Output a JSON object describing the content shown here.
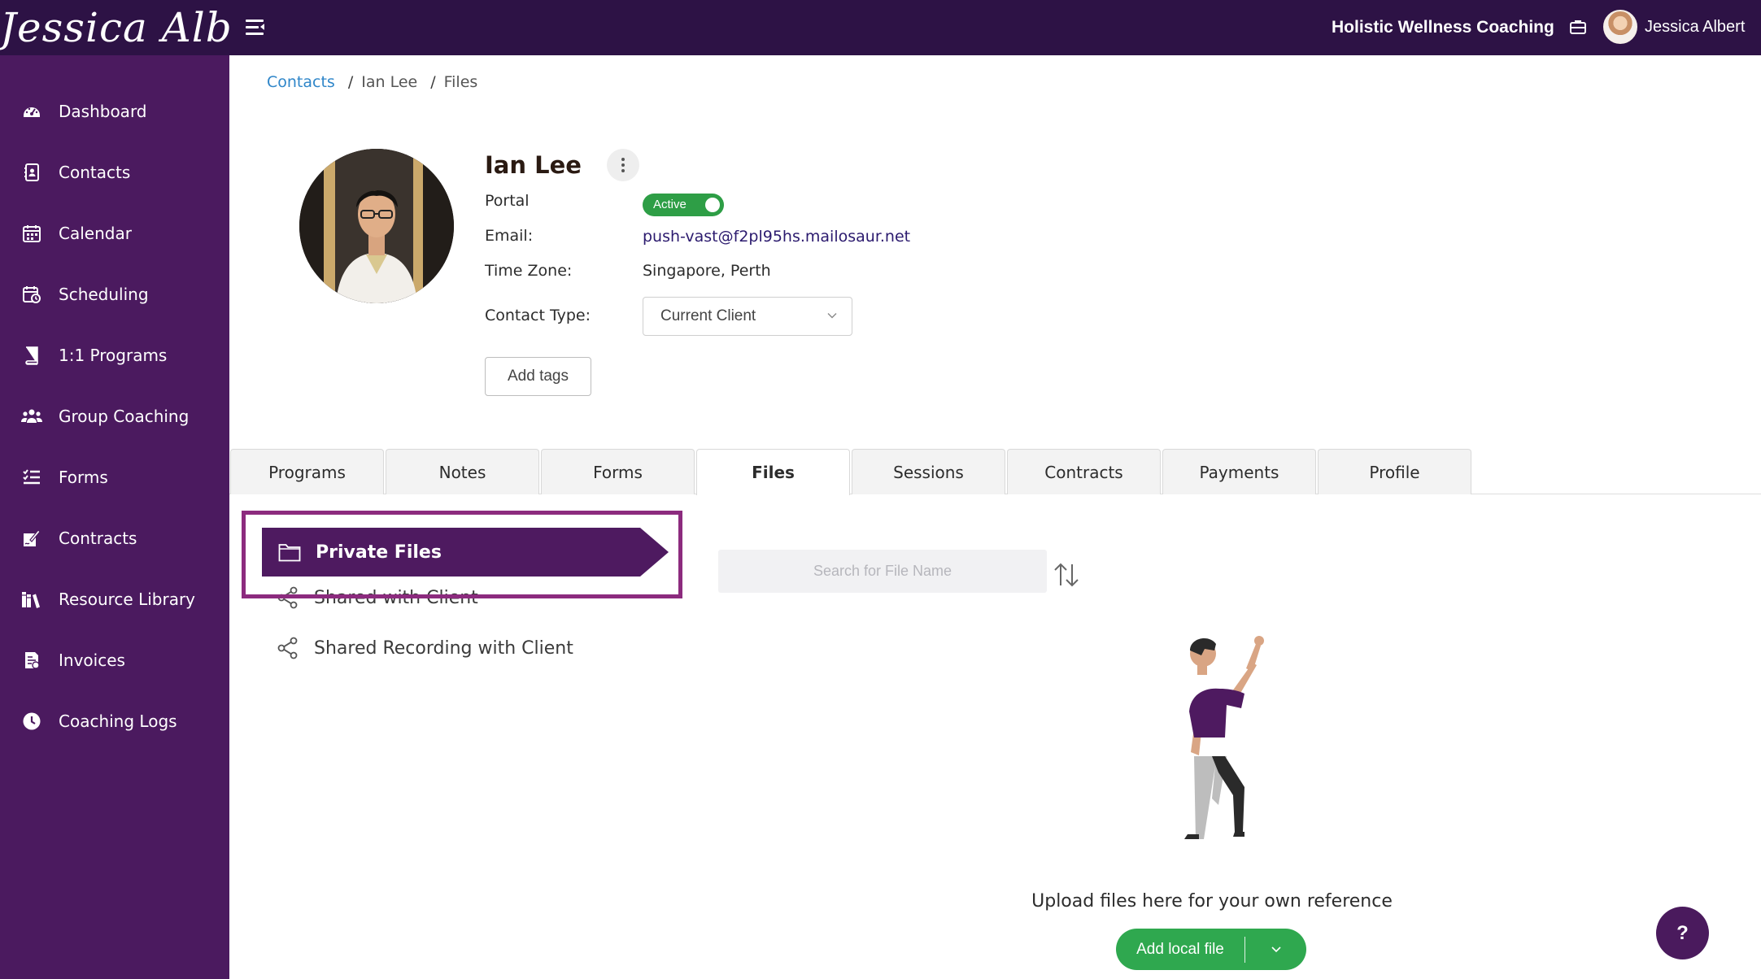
{
  "brand": {
    "logo_text": "Jessica Albert"
  },
  "header": {
    "org_name": "Holistic Wellness Coaching",
    "user_name": "Jessica Albert"
  },
  "sidebar": {
    "items": [
      {
        "label": "Dashboard",
        "icon": "dashboard-icon"
      },
      {
        "label": "Contacts",
        "icon": "contacts-icon"
      },
      {
        "label": "Calendar",
        "icon": "calendar-icon"
      },
      {
        "label": "Scheduling",
        "icon": "scheduling-icon"
      },
      {
        "label": "1:1 Programs",
        "icon": "book-icon"
      },
      {
        "label": "Group Coaching",
        "icon": "group-icon"
      },
      {
        "label": "Forms",
        "icon": "list-icon"
      },
      {
        "label": "Contracts",
        "icon": "contract-sign-icon"
      },
      {
        "label": "Resource Library",
        "icon": "library-icon"
      },
      {
        "label": "Invoices",
        "icon": "invoice-icon"
      },
      {
        "label": "Coaching Logs",
        "icon": "clock-icon"
      }
    ]
  },
  "breadcrumb": {
    "items": [
      "Contacts",
      "Ian Lee",
      "Files"
    ],
    "separator": "/"
  },
  "contact": {
    "name": "Ian Lee",
    "portal_label": "Portal",
    "portal_status": "Active",
    "email_label": "Email:",
    "email": "push-vast@f2pl95hs.mailosaur.net",
    "timezone_label": "Time Zone:",
    "timezone": "Singapore, Perth",
    "contact_type_label": "Contact Type:",
    "contact_type": "Current Client",
    "add_tags_label": "Add tags"
  },
  "tabs": [
    {
      "label": "Programs",
      "active": false
    },
    {
      "label": "Notes",
      "active": false
    },
    {
      "label": "Forms",
      "active": false
    },
    {
      "label": "Files",
      "active": true
    },
    {
      "label": "Sessions",
      "active": false
    },
    {
      "label": "Contracts",
      "active": false
    },
    {
      "label": "Payments",
      "active": false
    },
    {
      "label": "Profile",
      "active": false
    }
  ],
  "files": {
    "folders": [
      "Private Files",
      "Shared with Client",
      "Shared Recording with Client"
    ],
    "search_placeholder": "Search for File Name",
    "empty_message": "Upload files here for your own reference",
    "add_button_label": "Add local file"
  },
  "help": {
    "label": "?"
  },
  "colors": {
    "header_bg": "#2d1245",
    "sidebar_bg": "#4b1a5f",
    "accent_purple": "#4e1a60",
    "highlight_border": "#8c2b7e",
    "success_green": "#2fa84f",
    "link_blue": "#2f86c9"
  }
}
